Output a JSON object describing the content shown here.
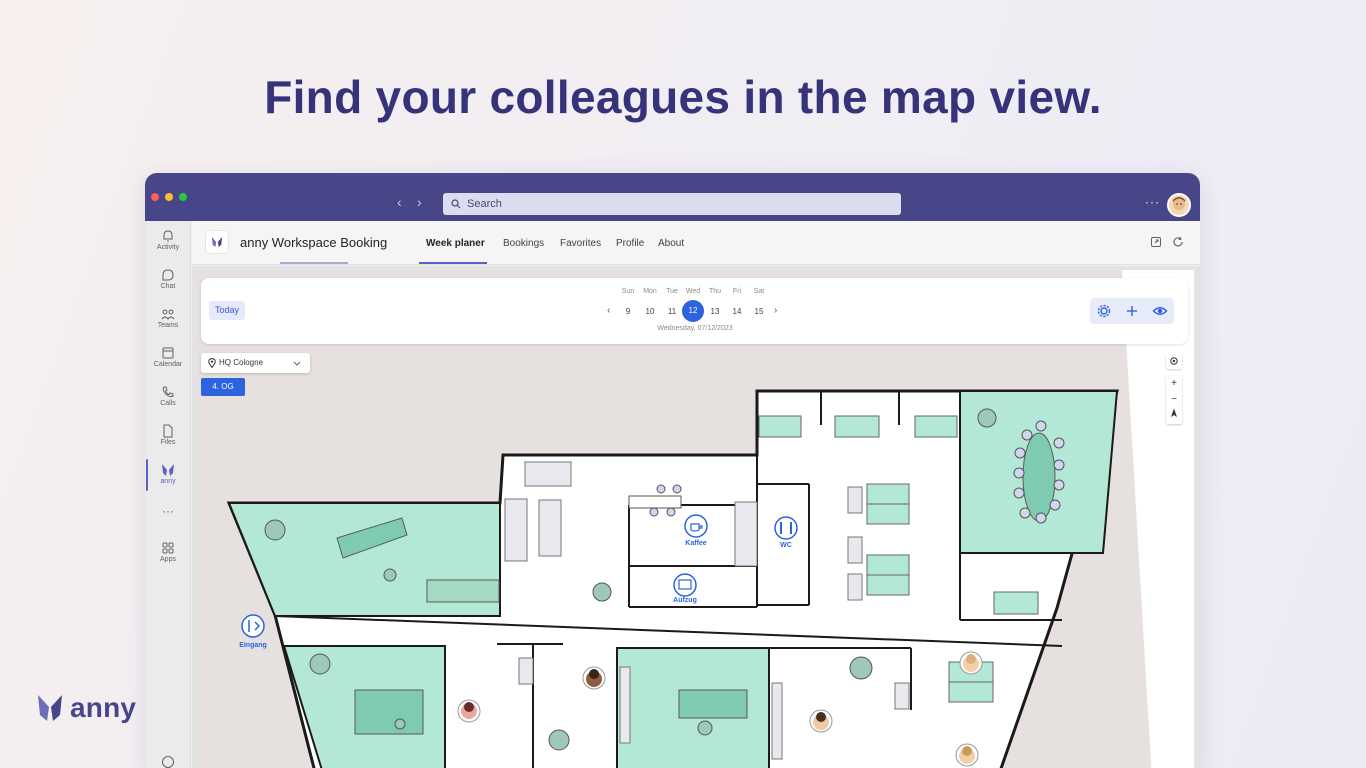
{
  "headline": "Find your colleagues in the map view.",
  "brand": {
    "name": "anny",
    "color": "#47468b"
  },
  "titlebar": {
    "search_placeholder": "Search",
    "more": "···",
    "color": "#464688"
  },
  "rail": {
    "items": [
      {
        "label": "Activity",
        "icon": "bell-icon"
      },
      {
        "label": "Chat",
        "icon": "chat-icon"
      },
      {
        "label": "Teams",
        "icon": "teams-icon"
      },
      {
        "label": "Calendar",
        "icon": "calendar-icon"
      },
      {
        "label": "Calls",
        "icon": "phone-icon"
      },
      {
        "label": "Files",
        "icon": "file-icon"
      },
      {
        "label": "anny",
        "icon": "anny-icon"
      },
      {
        "label": "···",
        "icon": "more-icon"
      },
      {
        "label": "Apps",
        "icon": "apps-icon"
      }
    ],
    "help": "?"
  },
  "app": {
    "title": "anny Workspace Booking",
    "tabs": [
      {
        "label": "Week planer",
        "active": true
      },
      {
        "label": "Bookings",
        "active": false
      },
      {
        "label": "Favorites",
        "active": false
      },
      {
        "label": "Profile",
        "active": false
      },
      {
        "label": "About",
        "active": false
      }
    ]
  },
  "planner": {
    "today": "Today",
    "days": [
      {
        "dow": "Sun",
        "num": "9"
      },
      {
        "dow": "Mon",
        "num": "10"
      },
      {
        "dow": "Tue",
        "num": "11"
      },
      {
        "dow": "Wed",
        "num": "12",
        "selected": true
      },
      {
        "dow": "Thu",
        "num": "13"
      },
      {
        "dow": "Fri",
        "num": "14"
      },
      {
        "dow": "Sat",
        "num": "15"
      }
    ],
    "date_label": "Wednesday, 07/12/2023",
    "accent": "#2c63e0"
  },
  "map": {
    "location": "HQ Cologne",
    "floor": "4. OG",
    "labels": {
      "kaffee": "Kaffee",
      "wc": "WC",
      "aufzug": "Aufzug",
      "eingang": "Eingang"
    },
    "room_color": "#b4e8d6",
    "zoom_in": "+",
    "zoom_out": "−"
  }
}
